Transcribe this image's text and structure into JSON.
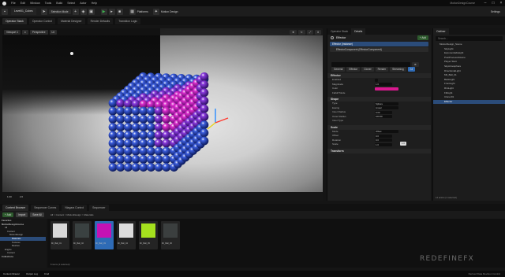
{
  "titlebar": {
    "menu": [
      "File",
      "Edit",
      "Window",
      "Tools",
      "Build",
      "Select",
      "Actor",
      "Help"
    ],
    "project_name": "MotionDesignCourse"
  },
  "toolbar": {
    "level_tab": "Level01_Cubes",
    "mode": "Selection Mode",
    "platforms": "Platforms",
    "motion_design": "Motion Design",
    "settings": "Settings"
  },
  "panel_tabs": [
    "Operator Stack",
    "Operator Control",
    "Material Designer",
    "Render Defaults",
    "Transition Logic"
  ],
  "viewport": {
    "tab": "Viewport 1",
    "perspective": "Perspective",
    "lit": "Lit",
    "status_left": "1.00",
    "status_right": "2.0"
  },
  "effector_panel": {
    "tabs": [
      "Operator Stack",
      "Details"
    ],
    "title": "Effector",
    "add_label": "+ Add",
    "components": [
      "Effector (Instance)",
      "EffectorComponent (EffectorComponent)"
    ],
    "subtabs": [
      "General",
      "Effector",
      "Cloner",
      "Render",
      "Streaming",
      "All"
    ],
    "sections": {
      "effector": "Effector",
      "shape": "Shape",
      "scale": "Scale",
      "transform": "Transform"
    },
    "props_effector": [
      {
        "label": "Enabled",
        "value": ""
      },
      {
        "label": "Magnitude",
        "value": "1.0"
      },
      {
        "label": "Color",
        "value": ""
      },
      {
        "label": "Falloff Mode",
        "value": ""
      }
    ],
    "props_shape": [
      {
        "label": "Type",
        "value": "Sphere"
      },
      {
        "label": "Easing",
        "value": "Linear"
      },
      {
        "label": "Inner Radius",
        "value": "0.00"
      },
      {
        "label": "Outer Radius",
        "value": "100.00"
      },
      {
        "label": "Inner Type",
        "value": ""
      }
    ],
    "props_scale": [
      {
        "label": "Mode",
        "value": "Offset"
      },
      {
        "label": "Offset",
        "value": "0.0"
      },
      {
        "label": "Rotation",
        "value": "0.0"
      },
      {
        "label": "Scale",
        "value": "1.0"
      }
    ],
    "tooltip": "1.0"
  },
  "outliner": {
    "tab": "Outliner",
    "search": "Search...",
    "rows": [
      "MotionDesign_Scene",
      "SkyLight",
      "ExponentialHeight",
      "PostProcessVolume",
      "Player Start",
      "SkyAtmosphere",
      "DirectionalLight",
      "Mtl_Ball_01",
      "BackLight",
      "FrontLight",
      "RimLight",
      "FillLight",
      "Cloner01",
      "Effector"
    ],
    "footer": "14 actors (1 selected)"
  },
  "content_browser": {
    "tabs": [
      "Content Browser",
      "Sequencer Curves",
      "Niagara Control",
      "Sequencer"
    ],
    "add_label": "+ Add",
    "import_label": "Import",
    "save_label": "Save All",
    "breadcrumb": "All > Content > MotionDesign > Materials",
    "tree": [
      "Favorites",
      "MotionDesignCourse",
      "All",
      "Content",
      "MotionDesign",
      "Materials",
      "Textures",
      "Meshes",
      "Engine",
      "Content",
      "Collections"
    ],
    "tiles": [
      {
        "label": "MI_Ball_01",
        "color": "#d8d8d8"
      },
      {
        "label": "MI_Ball_02",
        "color": "#3a4141"
      },
      {
        "label": "MI_Ball_03",
        "color": "#c412b4"
      },
      {
        "label": "MI_Ball_04",
        "color": "#dcdcdc"
      },
      {
        "label": "MI_Ball_05",
        "color": "#a4e01e"
      },
      {
        "label": "MI_Ball_06",
        "color": "#3b3f3f"
      }
    ],
    "footer": "6 items (1 selected)"
  },
  "watermark": "REDEFINEFX",
  "statusbar": {
    "items": [
      "Content Drawer",
      "Output Log",
      "Cmd"
    ],
    "right": "Derived Data  Revision Control"
  }
}
